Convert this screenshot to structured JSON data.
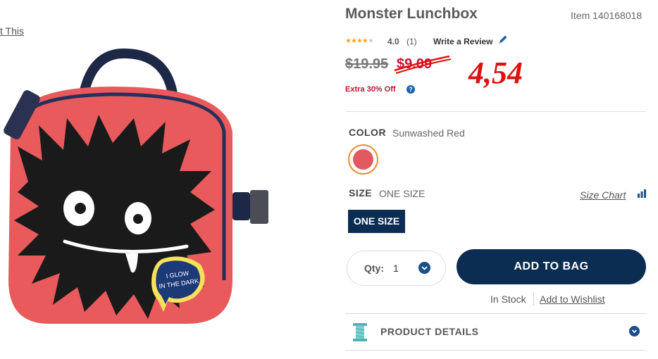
{
  "left": {
    "pin_link": "t This"
  },
  "product": {
    "title": "Monster Lunchbox",
    "item_number": "Item 140168018",
    "rating_value": "4.0",
    "rating_stars": 4,
    "review_count": "(1)",
    "write_review": "Write a Review",
    "original_price": "$19.95",
    "sale_price": "$9.09",
    "handwritten_price": "4,54",
    "promo": "Extra 30% Off",
    "help_glyph": "?",
    "bag_badge": "I GLOW IN THE DARK"
  },
  "color": {
    "label": "COLOR",
    "value": "Sunwashed Red",
    "swatch_hex": "#e25a60"
  },
  "size": {
    "label": "SIZE",
    "value": "ONE SIZE",
    "chart_link": "Size Chart",
    "selected_option": "ONE SIZE"
  },
  "purchase": {
    "qty_label": "Qty:",
    "qty_value": "1",
    "add_to_bag": "ADD TO BAG",
    "stock": "In Stock",
    "wishlist": "Add to Wishlist"
  },
  "details": {
    "label": "PRODUCT DETAILS"
  },
  "colors": {
    "navy": "#0b2d52",
    "sale_red": "#c8102e",
    "accent_blue": "#1c4f8a",
    "swatch_ring": "#f08a24"
  },
  "icons": [
    "pencil-icon",
    "help-icon",
    "bar-chart-icon",
    "chevron-down-icon",
    "thread-spool-icon",
    "star-icon"
  ]
}
